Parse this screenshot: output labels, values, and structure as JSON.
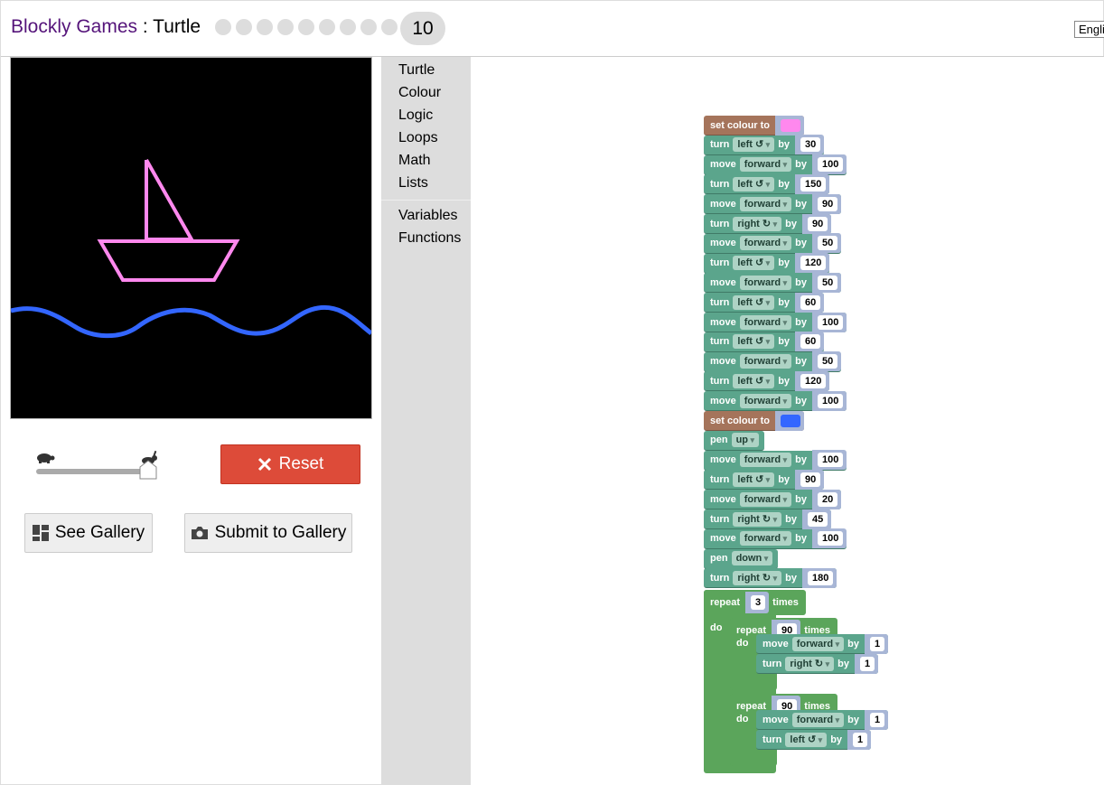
{
  "header": {
    "brand": "Blockly Games",
    "separator": " : ",
    "game": "Turtle",
    "level_dots": 9,
    "current_level": "10",
    "language": "English"
  },
  "display": {
    "background": "#000000",
    "boat_colour": "#ff88ee",
    "wave_colour": "#3366ff"
  },
  "controls": {
    "speed_level": 1.0,
    "reset_label": "Reset",
    "gallery_label": "See Gallery",
    "submit_label": "Submit to Gallery"
  },
  "toolbox": {
    "categories": [
      "Turtle",
      "Colour",
      "Logic",
      "Loops",
      "Math",
      "Lists"
    ],
    "extra": [
      "Variables",
      "Functions"
    ]
  },
  "program": [
    {
      "kind": "colour",
      "text": "set colour to",
      "colour": "#ff88ee"
    },
    {
      "kind": "turn",
      "dir": "left ↺",
      "by": "30"
    },
    {
      "kind": "move",
      "dir": "forward",
      "by": "100"
    },
    {
      "kind": "turn",
      "dir": "left ↺",
      "by": "150"
    },
    {
      "kind": "move",
      "dir": "forward",
      "by": "90"
    },
    {
      "kind": "turn",
      "dir": "right ↻",
      "by": "90"
    },
    {
      "kind": "move",
      "dir": "forward",
      "by": "50"
    },
    {
      "kind": "turn",
      "dir": "left ↺",
      "by": "120"
    },
    {
      "kind": "move",
      "dir": "forward",
      "by": "50"
    },
    {
      "kind": "turn",
      "dir": "left ↺",
      "by": "60"
    },
    {
      "kind": "move",
      "dir": "forward",
      "by": "100"
    },
    {
      "kind": "turn",
      "dir": "left ↺",
      "by": "60"
    },
    {
      "kind": "move",
      "dir": "forward",
      "by": "50"
    },
    {
      "kind": "turn",
      "dir": "left ↺",
      "by": "120"
    },
    {
      "kind": "move",
      "dir": "forward",
      "by": "100"
    },
    {
      "kind": "colour",
      "text": "set colour to",
      "colour": "#3366ff"
    },
    {
      "kind": "pen",
      "dir": "up"
    },
    {
      "kind": "move",
      "dir": "forward",
      "by": "100"
    },
    {
      "kind": "turn",
      "dir": "left ↺",
      "by": "90"
    },
    {
      "kind": "move",
      "dir": "forward",
      "by": "20"
    },
    {
      "kind": "turn",
      "dir": "right ↻",
      "by": "45"
    },
    {
      "kind": "move",
      "dir": "forward",
      "by": "100"
    },
    {
      "kind": "pen",
      "dir": "down"
    },
    {
      "kind": "turn",
      "dir": "right ↻",
      "by": "180"
    }
  ],
  "repeat_outer": {
    "label": "repeat",
    "times": "3",
    "suffix": "times",
    "do": "do"
  },
  "repeat_inner": [
    {
      "label": "repeat",
      "times": "90",
      "suffix": "times",
      "do": "do",
      "move": {
        "dir": "forward",
        "by": "1"
      },
      "turn": {
        "dir": "right ↻",
        "by": "1"
      }
    },
    {
      "label": "repeat",
      "times": "90",
      "suffix": "times",
      "do": "do",
      "move": {
        "dir": "forward",
        "by": "1"
      },
      "turn": {
        "dir": "left ↺",
        "by": "1"
      }
    }
  ],
  "labels": {
    "move": "move",
    "turn": "turn",
    "pen": "pen",
    "by": "by"
  }
}
